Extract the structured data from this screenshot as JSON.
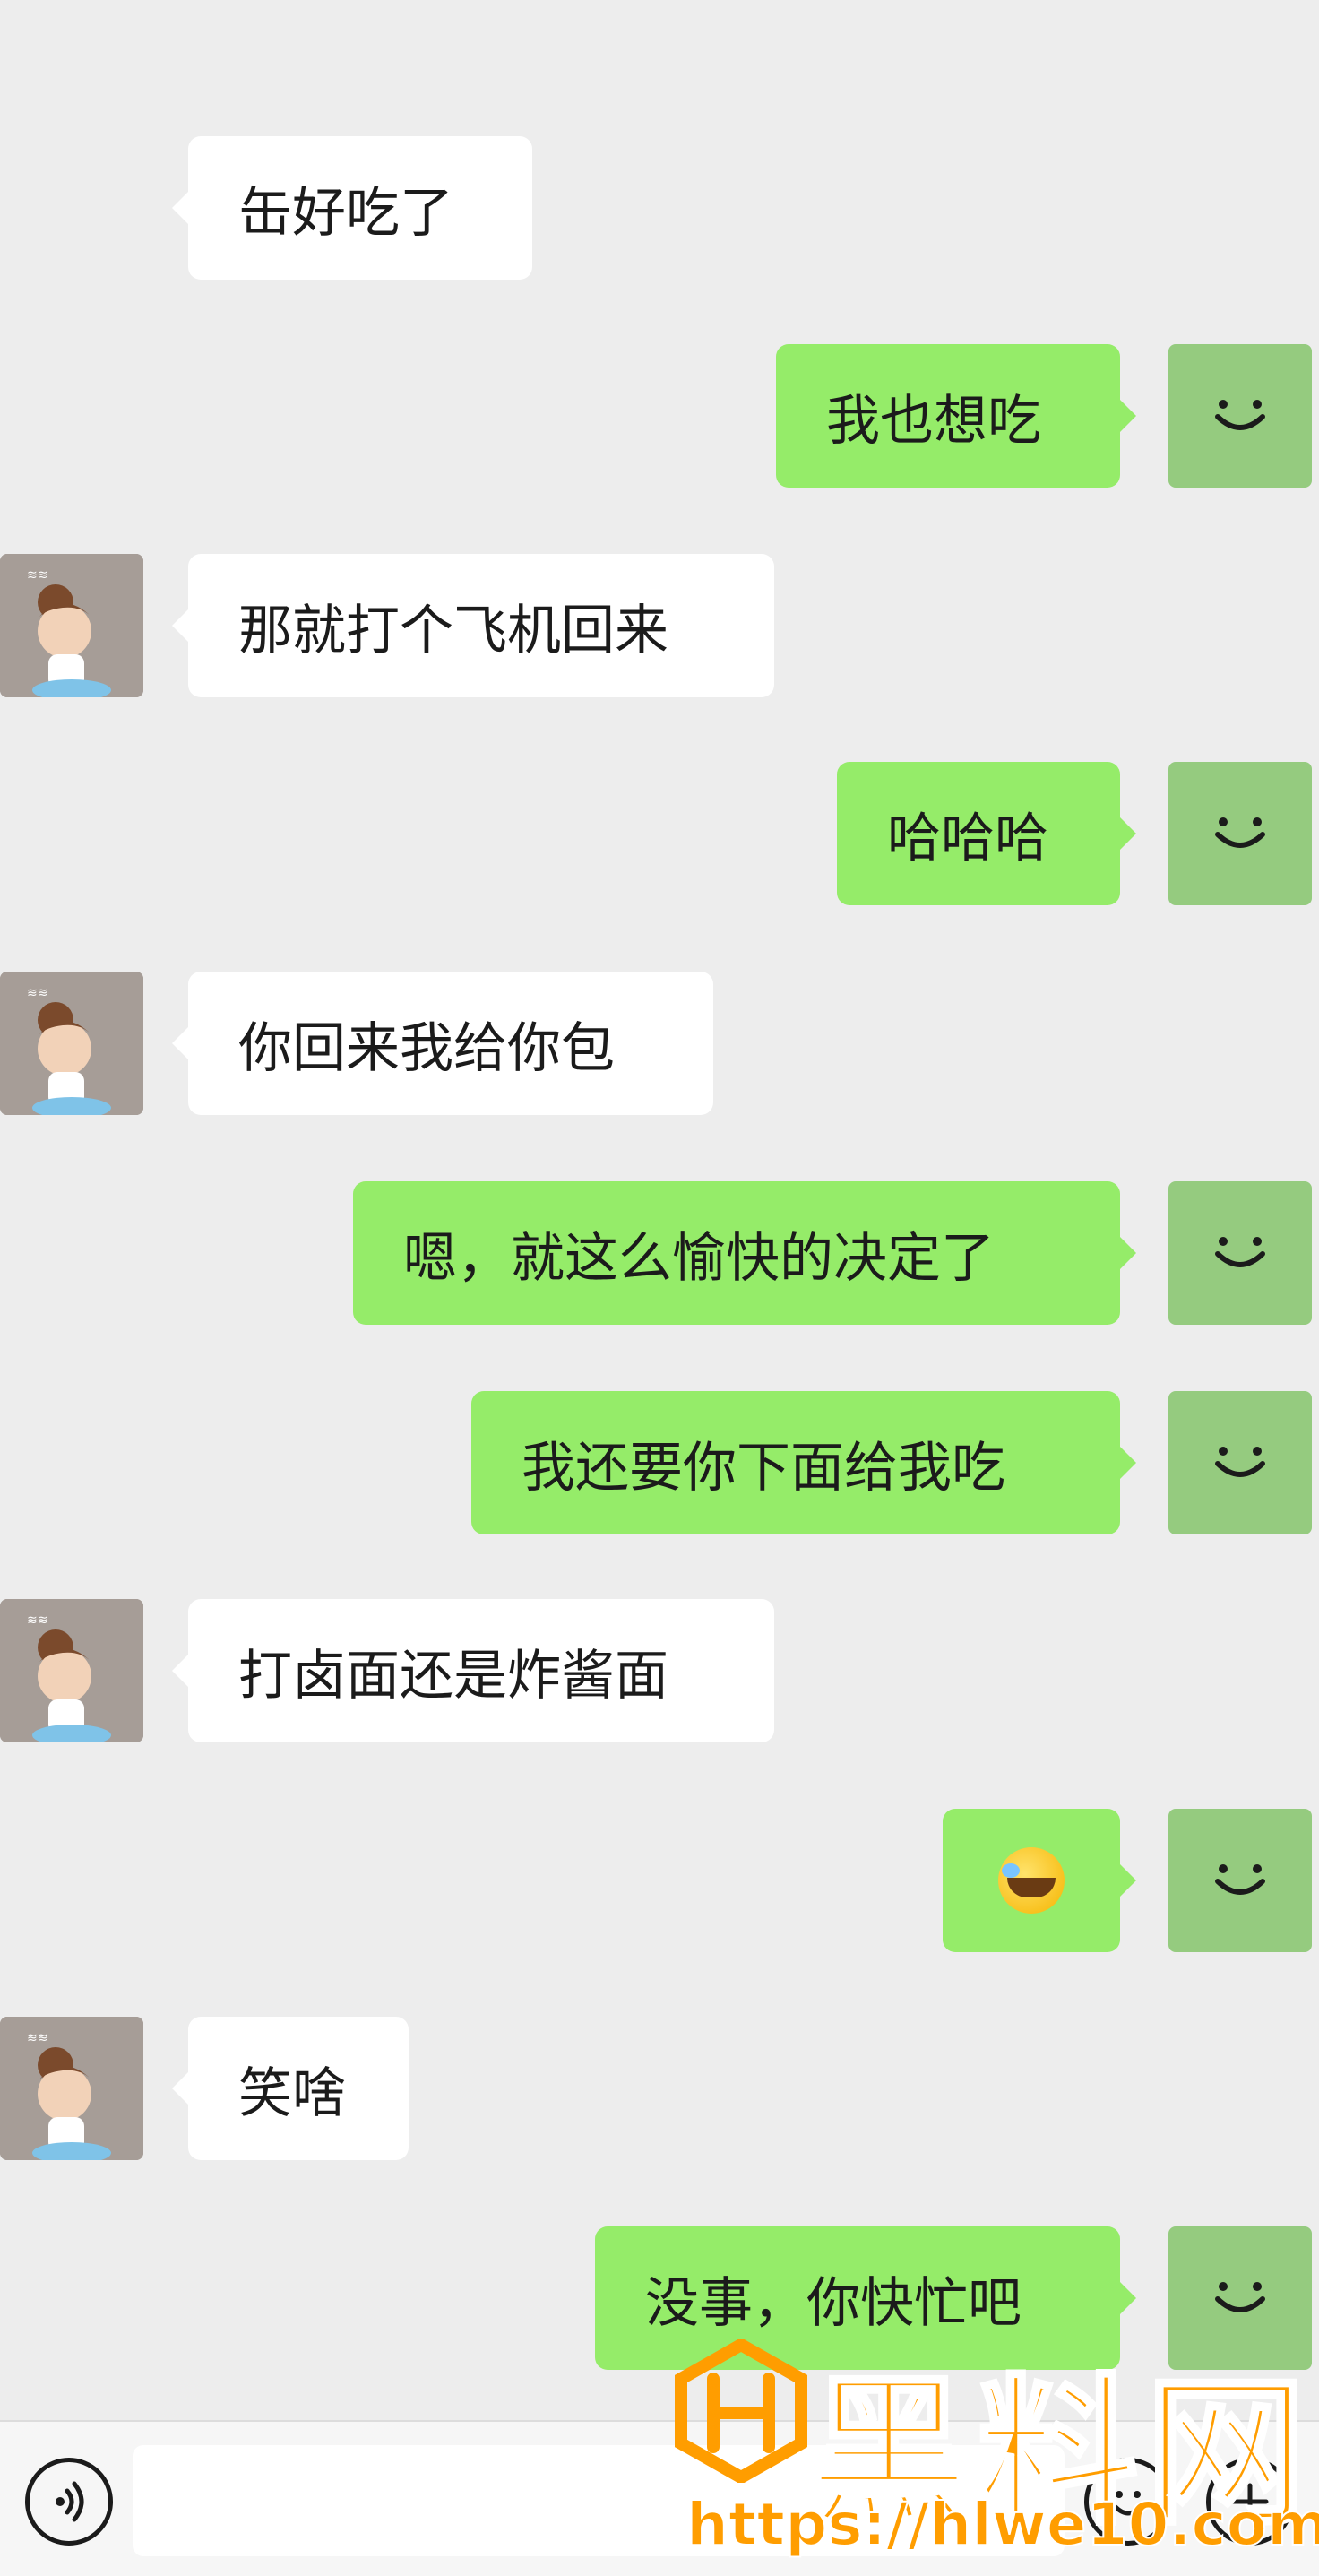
{
  "messages": [
    {
      "side": "in",
      "text": "缶好吃了",
      "avatar": false
    },
    {
      "side": "out",
      "text": "我也想吃"
    },
    {
      "side": "in",
      "text": "那就打个飞机回来",
      "avatar": true
    },
    {
      "side": "out",
      "text": "哈哈哈"
    },
    {
      "side": "in",
      "text": "你回来我给你包",
      "avatar": true
    },
    {
      "side": "out",
      "text": "嗯，就这么愉快的决定了"
    },
    {
      "side": "out",
      "text": "我还要你下面给我吃"
    },
    {
      "side": "in",
      "text": "打卤面还是炸酱面",
      "avatar": true
    },
    {
      "side": "out",
      "text": "",
      "emoji": "laughing-tears-emoji"
    },
    {
      "side": "in",
      "text": "笑啥",
      "avatar": true
    },
    {
      "side": "out",
      "text": "没事，你快忙吧"
    }
  ],
  "input_bar": {
    "voice_icon": "voice-icon",
    "emoji_icon": "smiley-icon",
    "more_icon": "plus-icon",
    "input_value": ""
  },
  "watermark": {
    "title": "黑料网",
    "url": "https://hlwe10.com"
  },
  "colors": {
    "background": "#ededed",
    "incoming_bubble": "#ffffff",
    "outgoing_bubble": "#95ec69",
    "self_avatar": "#95cb7f",
    "watermark": "#ff9d00"
  }
}
